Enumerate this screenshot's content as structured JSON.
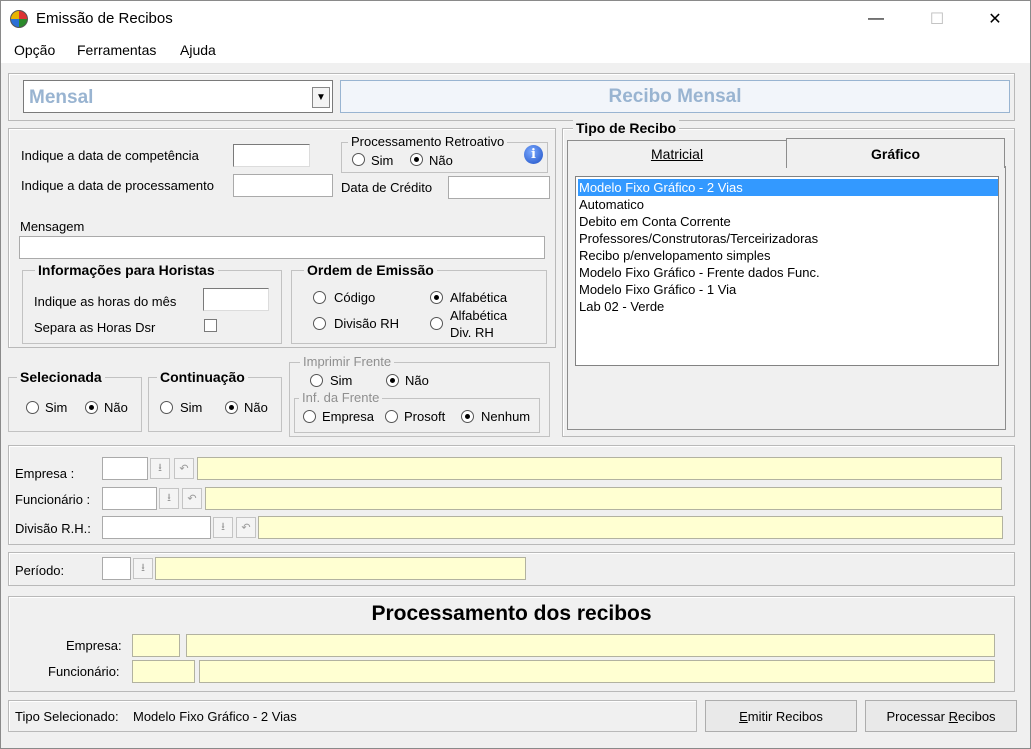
{
  "window": {
    "title": "Emissão de Recibos",
    "controls": {
      "minimize": "—",
      "maximize": "☐",
      "close": "✕"
    }
  },
  "menu": [
    "Opção",
    "Ferramentas",
    "Ajuda"
  ],
  "header": {
    "period_select": "Mensal",
    "receipt_title": "Recibo Mensal"
  },
  "params": {
    "competencia_label": "Indique a data de competência",
    "processamento_label": "Indique a data de processamento",
    "data_credito_label": "Data de Crédito",
    "mensagem_label": "Mensagem",
    "retroativo": {
      "title": "Processamento Retroativo",
      "sim": "Sim",
      "nao": "Não",
      "selected": "nao"
    },
    "horistas": {
      "title": "Informações para Horistas",
      "horas_label": "Indique as horas do mês",
      "dsr_label": "Separa as Horas Dsr"
    },
    "ordem": {
      "title": "Ordem de Emissão",
      "codigo": "Código",
      "divisao": "Divisão RH",
      "alfabetica": "Alfabética",
      "alfabetica_div_1": "Alfabética",
      "alfabetica_div_2": "Div. RH",
      "selected": "alfabetica"
    }
  },
  "selecionada": {
    "title": "Selecionada",
    "sim": "Sim",
    "nao": "Não",
    "selected": "nao"
  },
  "continuacao": {
    "title": "Continuação",
    "sim": "Sim",
    "nao": "Não",
    "selected": "nao"
  },
  "imprimir_frente": {
    "title": "Imprimir Frente",
    "sim": "Sim",
    "nao": "Não",
    "selected": "nao",
    "inf_title": "Inf. da Frente",
    "empresa": "Empresa",
    "prosoft": "Prosoft",
    "nenhum": "Nenhum",
    "inf_selected": "nenhum"
  },
  "tipo_recibo": {
    "title": "Tipo de Recibo",
    "tabs": [
      "Matricial",
      "Gráfico"
    ],
    "active_tab": "Gráfico",
    "items": [
      "Modelo Fixo Gráfico - 2 Vias",
      "Automatico",
      "Debito em Conta Corrente",
      "Professores/Construtoras/Terceirizadoras",
      "Recibo p/envelopamento simples",
      "Modelo Fixo Gráfico - Frente dados Func.",
      "Modelo Fixo Gráfico - 1 Via",
      "Lab 02 - Verde"
    ],
    "selected_index": 0
  },
  "filters": {
    "empresa_label": "Empresa :",
    "funcionario_label": "Funcionário :",
    "divisao_label": "Divisão R.H.:",
    "periodo_label": "Período:"
  },
  "processing": {
    "title": "Processamento dos recibos",
    "empresa_label": "Empresa:",
    "funcionario_label": "Funcionário:"
  },
  "footer": {
    "tipo_label": "Tipo Selecionado:",
    "tipo_value": "Modelo Fixo Gráfico - 2 Vias",
    "emitir_prefix": "E",
    "emitir_rest": "mitir Recibos",
    "processar_prefix": "Processar ",
    "processar_ul": "R",
    "processar_rest": "ecibos"
  }
}
